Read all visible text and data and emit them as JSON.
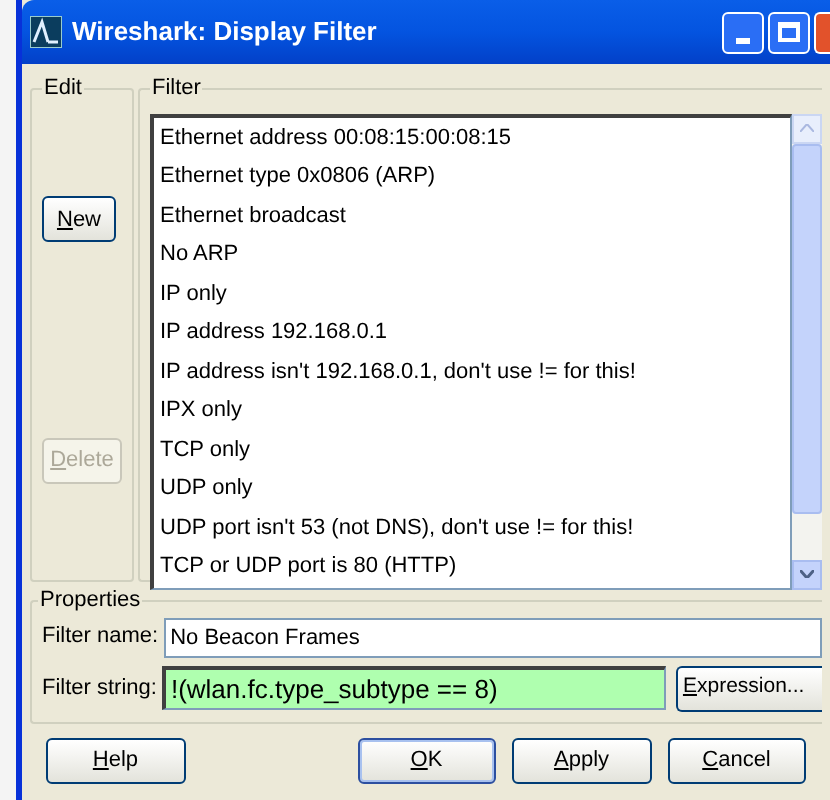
{
  "window": {
    "title": "Wireshark: Display Filter"
  },
  "edit_group": {
    "label": "Edit",
    "buttons": [
      {
        "label": "New",
        "disabled": false
      },
      {
        "label": "Delete",
        "disabled": true
      }
    ]
  },
  "filter_group": {
    "label": "Filter",
    "items": [
      {
        "label": "Ethernet address 00:08:15:00:08:15"
      },
      {
        "label": "Ethernet type 0x0806 (ARP)"
      },
      {
        "label": "Ethernet broadcast"
      },
      {
        "label": "No ARP"
      },
      {
        "label": "IP only"
      },
      {
        "label": "IP address 192.168.0.1"
      },
      {
        "label": "IP address isn't 192.168.0.1, don't use != for this!"
      },
      {
        "label": "IPX only"
      },
      {
        "label": "TCP only"
      },
      {
        "label": "UDP only"
      },
      {
        "label": "UDP port isn't 53 (not DNS), don't use != for this!"
      },
      {
        "label": "TCP or UDP port is 80 (HTTP)"
      }
    ]
  },
  "properties": {
    "label": "Properties",
    "filter_name": {
      "label": "Filter name:",
      "value": "No Beacon Frames"
    },
    "filter_string": {
      "label": "Filter string:",
      "value": "!(wlan.fc.type_subtype == 8)",
      "valid": true
    },
    "expression_button": "Expression..."
  },
  "buttons": [
    {
      "label": "Help",
      "default": false
    },
    {
      "label": "OK",
      "default": true
    },
    {
      "label": "Apply",
      "default": false
    },
    {
      "label": "Cancel",
      "default": false
    }
  ]
}
